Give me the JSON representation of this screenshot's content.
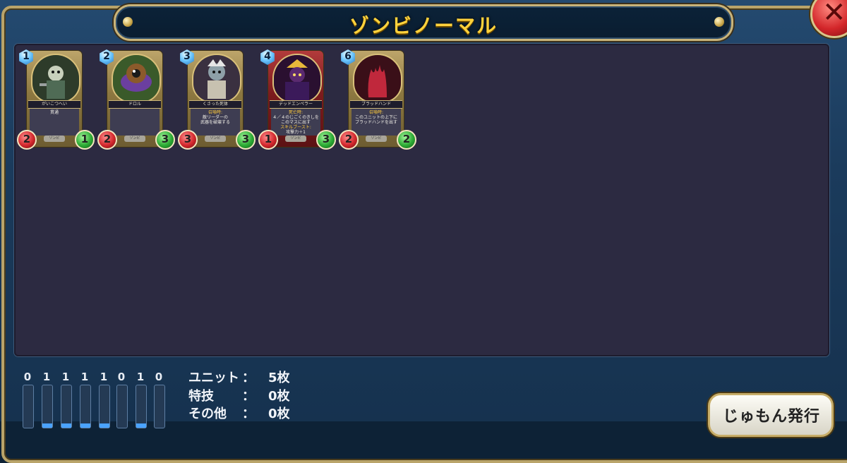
{
  "title": "ゾンビノーマル",
  "close_icon": "close-x-icon",
  "cards": [
    {
      "cost": "1",
      "name": "がいこつへい",
      "text": "貫通",
      "tribe": "ゾンビ",
      "atk": "2",
      "hp": "1",
      "frame": "silver"
    },
    {
      "cost": "2",
      "name": "ドロル",
      "text": "",
      "tribe": "ゾンビ",
      "atk": "2",
      "hp": "3",
      "frame": "silver"
    },
    {
      "cost": "3",
      "name": "くさった死体",
      "text_hl": "召喚時:",
      "text": "敵リーダーの\n武器を破壊する",
      "tribe": "ゾンビ",
      "atk": "3",
      "hp": "3",
      "frame": "silver"
    },
    {
      "cost": "4",
      "name": "デッドエンペラー",
      "text_hl": "死亡時:",
      "text": "４／４のじごくのきしを\nこのマスに出す",
      "text_hl2": "スキルブースト:",
      "text2": "攻撃力＋1",
      "tribe": "ゾンビ",
      "atk": "1",
      "hp": "3",
      "frame": "red"
    },
    {
      "cost": "6",
      "name": "ブラッドハンド",
      "text_hl": "召喚時:",
      "text": "このユニットの上下に\nブラッドハンドを出す",
      "tribe": "ゾンビ",
      "atk": "2",
      "hp": "2",
      "frame": "silver"
    }
  ],
  "cost_curve": [
    {
      "count": "0",
      "filled": false
    },
    {
      "count": "1",
      "filled": true
    },
    {
      "count": "1",
      "filled": true
    },
    {
      "count": "1",
      "filled": true
    },
    {
      "count": "1",
      "filled": true
    },
    {
      "count": "0",
      "filled": false
    },
    {
      "count": "1",
      "filled": true
    },
    {
      "count": "0",
      "filled": false
    }
  ],
  "summary": {
    "unit_label": "ユニット",
    "unit_value": "5枚",
    "skill_label": "特技",
    "skill_value": "0枚",
    "other_label": "その他",
    "other_value": "0枚",
    "colon": "："
  },
  "issue_button": "じゅもん発行"
}
